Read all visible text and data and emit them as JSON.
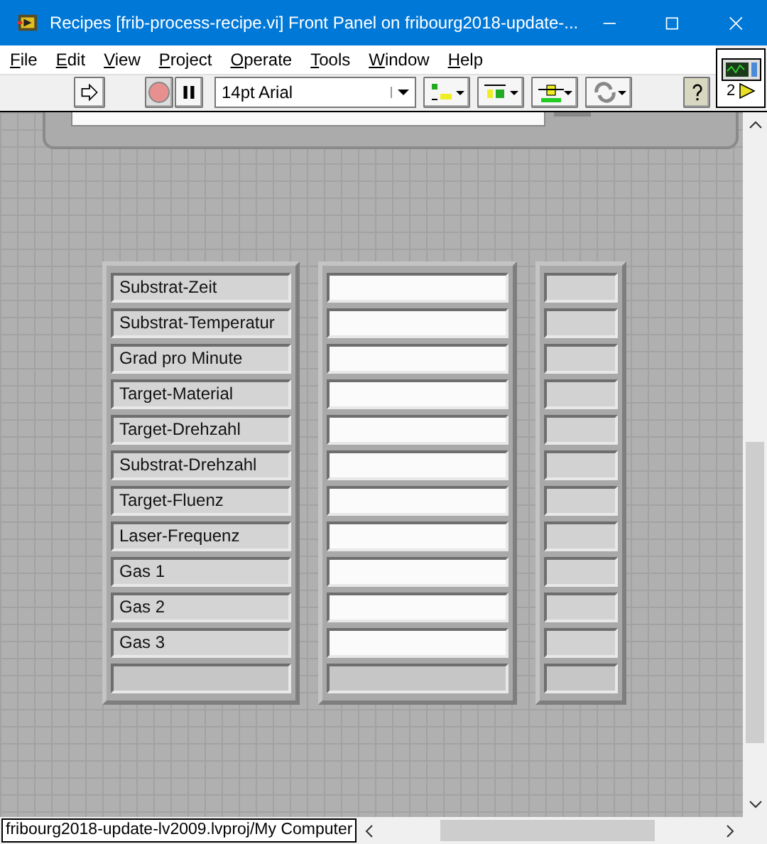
{
  "window": {
    "title": "Recipes [frib-process-recipe.vi] Front Panel on fribourg2018-update-..."
  },
  "menu": [
    "File",
    "Edit",
    "View",
    "Project",
    "Operate",
    "Tools",
    "Window",
    "Help"
  ],
  "toolbar": {
    "font": "14pt Arial"
  },
  "connector_pane": {
    "label": "2"
  },
  "rows": [
    {
      "label": "Substrat-Zeit"
    },
    {
      "label": "Substrat-Temperatur"
    },
    {
      "label": "Grad pro Minute"
    },
    {
      "label": "Target-Material"
    },
    {
      "label": "Target-Drehzahl"
    },
    {
      "label": "Substrat-Drehzahl"
    },
    {
      "label": "Target-Fluenz"
    },
    {
      "label": "Laser-Frequenz"
    },
    {
      "label": "Gas 1"
    },
    {
      "label": "Gas 2"
    },
    {
      "label": "Gas 3"
    }
  ],
  "status_bar": {
    "context": "fribourg2018-update-lv2009.lvproj/My Computer"
  }
}
